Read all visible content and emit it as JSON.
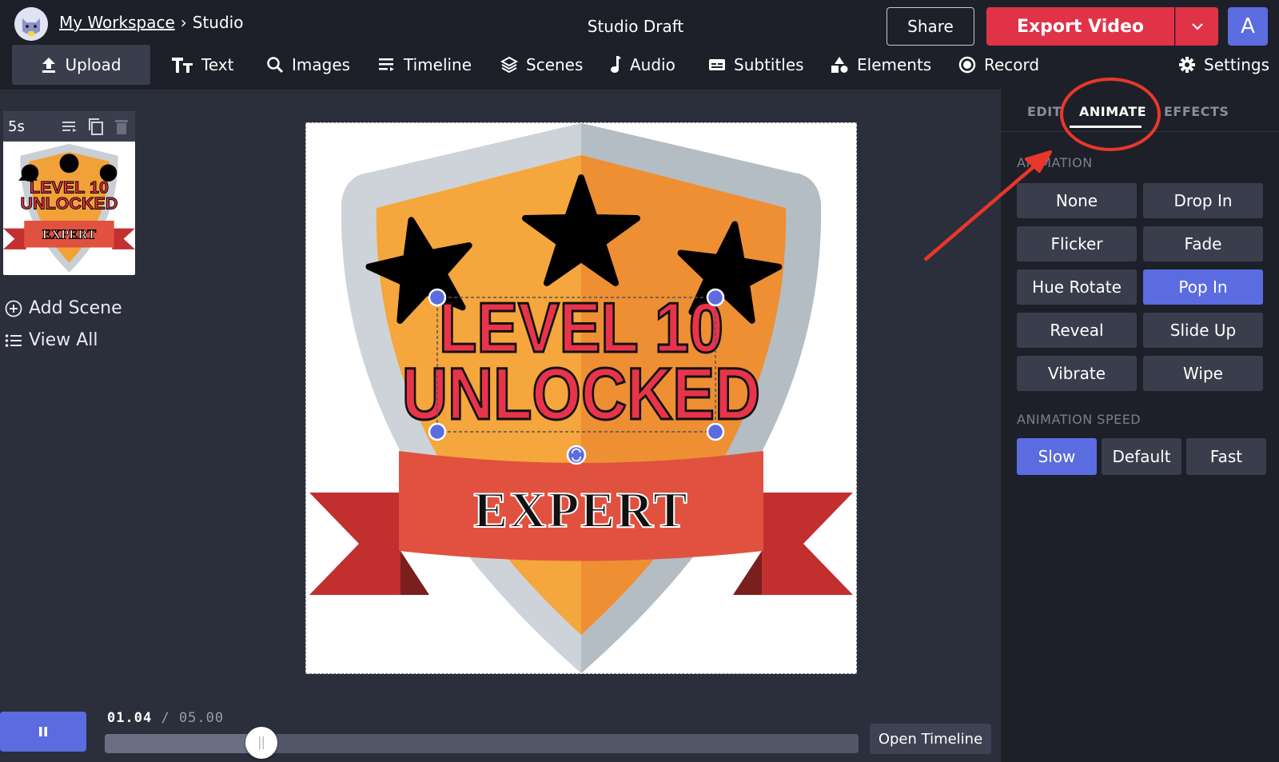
{
  "header": {
    "workspace_link": "My Workspace",
    "breadcrumb_sep": "›",
    "breadcrumb_current": "Studio",
    "project_title": "Studio Draft",
    "share_label": "Share",
    "export_label": "Export Video",
    "user_initial": "A"
  },
  "toolbar": {
    "upload": "Upload",
    "text": "Text",
    "images": "Images",
    "timeline": "Timeline",
    "scenes": "Scenes",
    "audio": "Audio",
    "subtitles": "Subtitles",
    "elements": "Elements",
    "record": "Record",
    "settings": "Settings"
  },
  "scenes": {
    "duration": "5s",
    "add_scene": "Add Scene",
    "view_all": "View All"
  },
  "canvas": {
    "headline_line1": "LEVEL 10",
    "headline_line2": "UNLOCKED",
    "ribbon_text": "EXPERT",
    "thumb_line1": "LEVEL 10",
    "thumb_line2": "UNLOCKED",
    "thumb_ribbon": "EXPERT"
  },
  "playback": {
    "current_time": "01.04",
    "separator": "/",
    "total_time": "05.00",
    "progress": 0.208,
    "open_timeline": "Open Timeline"
  },
  "panel": {
    "tabs": [
      "EDIT",
      "ANIMATE",
      "EFFECTS"
    ],
    "active_tab": "ANIMATE",
    "animation_label": "ANIMATION",
    "animations": [
      "None",
      "Drop In",
      "Flicker",
      "Fade",
      "Hue Rotate",
      "Pop In",
      "Reveal",
      "Slide Up",
      "Vibrate",
      "Wipe"
    ],
    "selected_animation": "Pop In",
    "speed_label": "ANIMATION SPEED",
    "speeds": [
      "Slow",
      "Default",
      "Fast"
    ],
    "selected_speed": "Slow"
  },
  "colors": {
    "accent": "#5b6ce0",
    "export_red": "#e03348",
    "annotation_red": "#e8372a",
    "shield_orange": "#f2a138",
    "ribbon_red": "#e0513f"
  }
}
